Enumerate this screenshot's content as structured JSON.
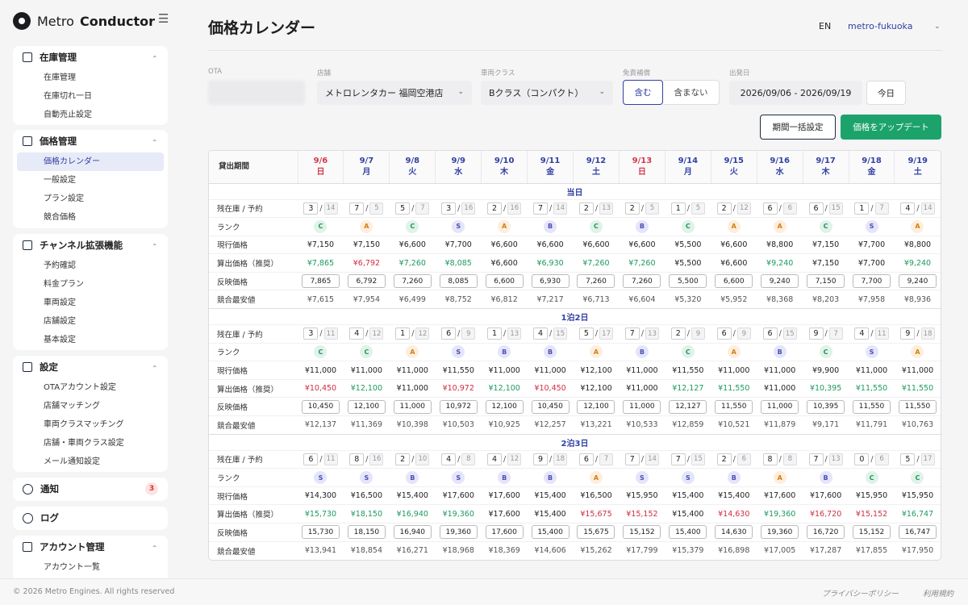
{
  "app": {
    "name_light": "Metro",
    "name_bold": "Conductor"
  },
  "sidebar": {
    "groups": [
      {
        "title": "在庫管理",
        "items": [
          "在庫管理",
          "在庫切れ一日",
          "自動売止設定"
        ]
      },
      {
        "title": "価格管理",
        "items": [
          "価格カレンダー",
          "一般設定",
          "プラン設定",
          "競合価格"
        ]
      },
      {
        "title": "チャンネル拡張機能",
        "items": [
          "予約確認",
          "料金プラン",
          "車両設定",
          "店舗設定",
          "基本設定"
        ]
      },
      {
        "title": "設定",
        "items": [
          "OTAアカウント設定",
          "店舗マッチング",
          "車両クラスマッチング",
          "店舗・車両クラス設定",
          "メール通知設定"
        ]
      },
      {
        "title": "通知",
        "badge": "3"
      },
      {
        "title": "ログ"
      },
      {
        "title": "アカウント管理",
        "items": [
          "アカウント一覧"
        ]
      }
    ]
  },
  "header": {
    "title": "価格カレンダー",
    "lang": "EN",
    "account": "metro-fukuoka"
  },
  "filters": {
    "ota_label": "OTA",
    "store_label": "店舗",
    "store_value": "メトロレンタカー 福岡空港店",
    "class_label": "車両クラス",
    "class_value": "Bクラス（コンパクト）",
    "insurance_label": "免責補償",
    "insurance_on": "含む",
    "insurance_off": "含まない",
    "date_label": "出発日",
    "date_value": "2026/09/06 - 2026/09/19",
    "today": "今日"
  },
  "actions": {
    "bulk": "期間一括設定",
    "update": "価格をアップデート"
  },
  "grid": {
    "corner": "貸出期間",
    "dates": [
      {
        "d": "9/6",
        "w": "日",
        "sun": true
      },
      {
        "d": "9/7",
        "w": "月"
      },
      {
        "d": "9/8",
        "w": "火"
      },
      {
        "d": "9/9",
        "w": "水"
      },
      {
        "d": "9/10",
        "w": "木"
      },
      {
        "d": "9/11",
        "w": "金"
      },
      {
        "d": "9/12",
        "w": "土"
      },
      {
        "d": "9/13",
        "w": "日",
        "sun": true
      },
      {
        "d": "9/14",
        "w": "月"
      },
      {
        "d": "9/15",
        "w": "火"
      },
      {
        "d": "9/16",
        "w": "水"
      },
      {
        "d": "9/17",
        "w": "木"
      },
      {
        "d": "9/18",
        "w": "金"
      },
      {
        "d": "9/19",
        "w": "土"
      }
    ],
    "row_labels": {
      "stock": "残在庫 / 予約",
      "rank": "ランク",
      "current": "現行価格",
      "calc": "算出価格（推奨）",
      "reflect": "反映価格",
      "comp": "競合最安値"
    },
    "sections": [
      {
        "title": "当日",
        "stock": [
          [
            3,
            14
          ],
          [
            7,
            5
          ],
          [
            5,
            7
          ],
          [
            3,
            16
          ],
          [
            2,
            16
          ],
          [
            7,
            14
          ],
          [
            2,
            13
          ],
          [
            2,
            5
          ],
          [
            1,
            5
          ],
          [
            2,
            12
          ],
          [
            6,
            6
          ],
          [
            6,
            15
          ],
          [
            1,
            7
          ],
          [
            4,
            14
          ]
        ],
        "rank": [
          "C",
          "A",
          "C",
          "S",
          "A",
          "B",
          "C",
          "B",
          "C",
          "A",
          "A",
          "C",
          "S",
          "A"
        ],
        "current": [
          "¥7,150",
          "¥7,150",
          "¥6,600",
          "¥7,700",
          "¥6,600",
          "¥6,600",
          "¥6,600",
          "¥6,600",
          "¥5,500",
          "¥6,600",
          "¥8,800",
          "¥7,150",
          "¥7,700",
          "¥8,800"
        ],
        "calc": [
          "¥7,865",
          "¥6,792",
          "¥7,260",
          "¥8,085",
          "¥6,600",
          "¥6,930",
          "¥7,260",
          "¥7,260",
          "¥5,500",
          "¥6,600",
          "¥9,240",
          "¥7,150",
          "¥7,700",
          "¥9,240"
        ],
        "calc_dir": [
          "up",
          "dn",
          "up",
          "up",
          "eq",
          "up",
          "up",
          "up",
          "eq",
          "eq",
          "up",
          "eq",
          "eq",
          "up"
        ],
        "reflect": [
          "7,865",
          "6,792",
          "7,260",
          "8,085",
          "6,600",
          "6,930",
          "7,260",
          "7,260",
          "5,500",
          "6,600",
          "9,240",
          "7,150",
          "7,700",
          "9,240"
        ],
        "comp": [
          "¥7,615",
          "¥7,954",
          "¥6,499",
          "¥8,752",
          "¥6,812",
          "¥7,217",
          "¥6,713",
          "¥6,604",
          "¥5,320",
          "¥5,952",
          "¥8,368",
          "¥8,203",
          "¥7,958",
          "¥8,936"
        ]
      },
      {
        "title": "1泊2日",
        "stock": [
          [
            3,
            11
          ],
          [
            4,
            12
          ],
          [
            1,
            12
          ],
          [
            6,
            9
          ],
          [
            1,
            13
          ],
          [
            4,
            15
          ],
          [
            5,
            17
          ],
          [
            7,
            13
          ],
          [
            2,
            9
          ],
          [
            6,
            9
          ],
          [
            6,
            15
          ],
          [
            9,
            7
          ],
          [
            4,
            11
          ],
          [
            9,
            18
          ]
        ],
        "rank": [
          "C",
          "C",
          "A",
          "S",
          "B",
          "B",
          "A",
          "B",
          "C",
          "A",
          "B",
          "C",
          "S",
          "A"
        ],
        "current": [
          "¥11,000",
          "¥11,000",
          "¥11,000",
          "¥11,550",
          "¥11,000",
          "¥11,000",
          "¥12,100",
          "¥11,000",
          "¥11,550",
          "¥11,000",
          "¥11,000",
          "¥9,900",
          "¥11,000",
          "¥11,000"
        ],
        "calc": [
          "¥10,450",
          "¥12,100",
          "¥11,000",
          "¥10,972",
          "¥12,100",
          "¥10,450",
          "¥12,100",
          "¥11,000",
          "¥12,127",
          "¥11,550",
          "¥11,000",
          "¥10,395",
          "¥11,550",
          "¥11,550"
        ],
        "calc_dir": [
          "dn",
          "up",
          "eq",
          "dn",
          "up",
          "dn",
          "eq",
          "eq",
          "up",
          "up",
          "eq",
          "up",
          "up",
          "up"
        ],
        "reflect": [
          "10,450",
          "12,100",
          "11,000",
          "10,972",
          "12,100",
          "10,450",
          "12,100",
          "11,000",
          "12,127",
          "11,550",
          "11,000",
          "10,395",
          "11,550",
          "11,550"
        ],
        "comp": [
          "¥12,137",
          "¥11,369",
          "¥10,398",
          "¥10,503",
          "¥10,925",
          "¥12,257",
          "¥13,221",
          "¥10,533",
          "¥12,859",
          "¥10,521",
          "¥11,879",
          "¥9,171",
          "¥11,791",
          "¥10,763"
        ]
      },
      {
        "title": "2泊3日",
        "stock": [
          [
            6,
            11
          ],
          [
            8,
            16
          ],
          [
            2,
            10
          ],
          [
            4,
            8
          ],
          [
            4,
            12
          ],
          [
            9,
            18
          ],
          [
            6,
            7
          ],
          [
            7,
            14
          ],
          [
            7,
            15
          ],
          [
            2,
            6
          ],
          [
            8,
            8
          ],
          [
            7,
            13
          ],
          [
            0,
            6
          ],
          [
            5,
            17
          ]
        ],
        "rank": [
          "S",
          "S",
          "B",
          "S",
          "B",
          "B",
          "A",
          "S",
          "S",
          "B",
          "A",
          "B",
          "C",
          "C"
        ],
        "current": [
          "¥14,300",
          "¥16,500",
          "¥15,400",
          "¥17,600",
          "¥17,600",
          "¥15,400",
          "¥16,500",
          "¥15,950",
          "¥15,400",
          "¥15,400",
          "¥17,600",
          "¥17,600",
          "¥15,950",
          "¥15,950"
        ],
        "calc": [
          "¥15,730",
          "¥18,150",
          "¥16,940",
          "¥19,360",
          "¥17,600",
          "¥15,400",
          "¥15,675",
          "¥15,152",
          "¥15,400",
          "¥14,630",
          "¥19,360",
          "¥16,720",
          "¥15,152",
          "¥16,747"
        ],
        "calc_dir": [
          "up",
          "up",
          "up",
          "up",
          "eq",
          "eq",
          "dn",
          "dn",
          "eq",
          "dn",
          "up",
          "dn",
          "dn",
          "up"
        ],
        "reflect": [
          "15,730",
          "18,150",
          "16,940",
          "19,360",
          "17,600",
          "15,400",
          "15,675",
          "15,152",
          "15,400",
          "14,630",
          "19,360",
          "16,720",
          "15,152",
          "16,747"
        ],
        "comp": [
          "¥13,941",
          "¥18,854",
          "¥16,271",
          "¥18,968",
          "¥18,369",
          "¥14,606",
          "¥15,262",
          "¥17,799",
          "¥15,379",
          "¥16,898",
          "¥17,005",
          "¥17,287",
          "¥17,855",
          "¥17,950"
        ]
      }
    ]
  },
  "footer": {
    "copyright": "© 2026 Metro Engines. All rights reserved",
    "privacy": "プライバシーポリシー",
    "terms": "利用規約"
  }
}
